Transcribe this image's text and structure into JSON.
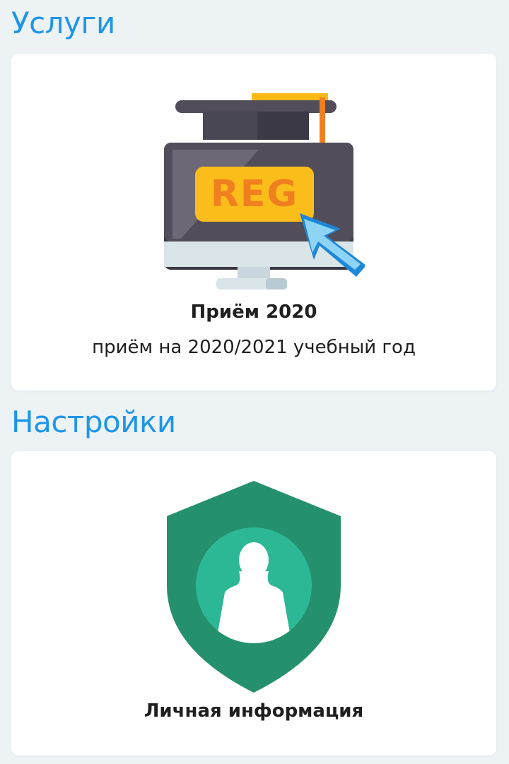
{
  "services": {
    "heading": "Услуги",
    "cards": [
      {
        "title": "Приём 2020",
        "subtitle": "приём на 2020/2021 учебный год",
        "icon": "registration-monitor-icon",
        "badge_text": "REG"
      }
    ]
  },
  "settings": {
    "heading": "Настройки",
    "cards": [
      {
        "title": "Личная информация",
        "icon": "user-shield-icon"
      }
    ]
  },
  "colors": {
    "background": "#edf2f5",
    "heading": "#1e96e8",
    "card": "#ffffff",
    "text": "#1f1f1f",
    "shield": "#25906d",
    "shield_circle": "#2cb894",
    "reg_badge": "#fbbd1a",
    "reg_text": "#f07f20"
  }
}
